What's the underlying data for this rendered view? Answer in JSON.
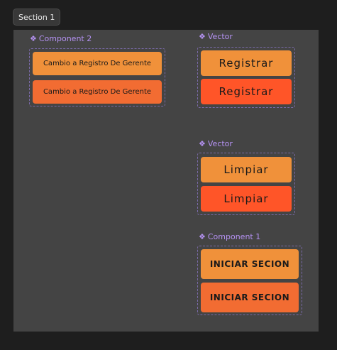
{
  "section": {
    "title": "Section 1"
  },
  "component2": {
    "label": "Component 2",
    "buttons": [
      {
        "text": "Cambio a Registro De Gerente",
        "color": "#f0913a"
      },
      {
        "text": "Cambio a Registro De Gerente",
        "color": "#f26c32"
      }
    ]
  },
  "vector_registrar": {
    "label": "Vector",
    "buttons": [
      {
        "text": "Registrar",
        "color": "#f0913a"
      },
      {
        "text": "Registrar",
        "color": "#ff5528"
      }
    ]
  },
  "vector_limpiar": {
    "label": "Vector",
    "buttons": [
      {
        "text": "Limpiar",
        "color": "#f0913a"
      },
      {
        "text": "Limpiar",
        "color": "#ff5528"
      }
    ]
  },
  "component1": {
    "label": "Component 1",
    "buttons": [
      {
        "text": "INICIAR SECION",
        "color": "#f0913a"
      },
      {
        "text": "INICIAR SECION",
        "color": "#f26c32"
      }
    ]
  },
  "icons": {
    "component": "component-icon"
  },
  "colors": {
    "canvas": "#1e1e1e",
    "frame": "#444444",
    "label": "#b592f3"
  }
}
